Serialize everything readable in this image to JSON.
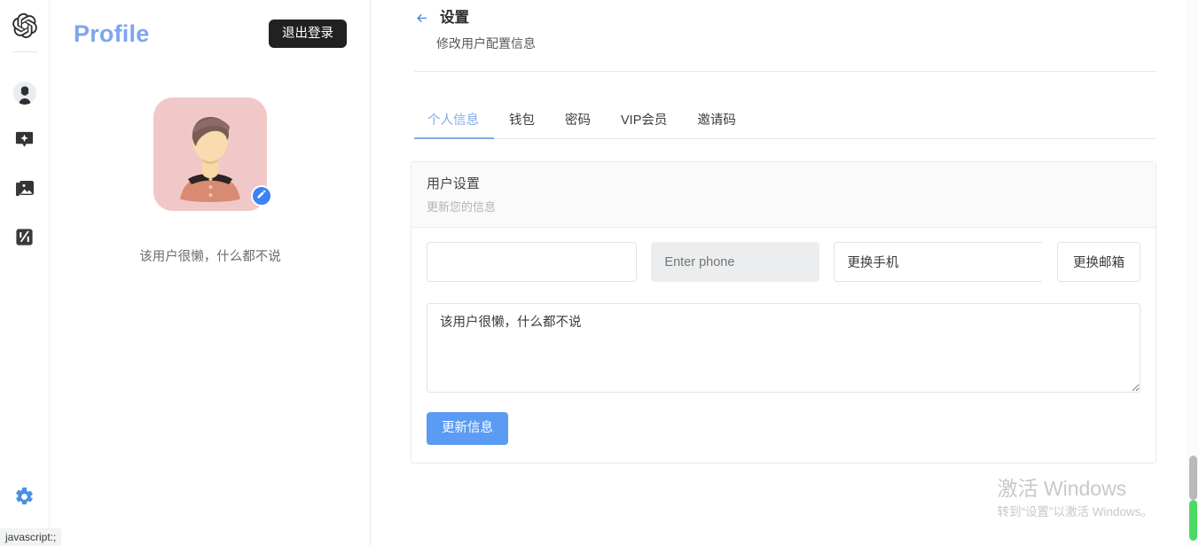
{
  "rail": {
    "logo_icon": "openai-logo-icon",
    "items": [
      {
        "icon": "user-avatar-icon",
        "name": "rail-item-account"
      },
      {
        "icon": "sparkle-badge-icon",
        "name": "rail-item-assistant"
      },
      {
        "icon": "image-library-icon",
        "name": "rail-item-gallery"
      },
      {
        "icon": "brand-mark-icon",
        "name": "rail-item-apps"
      }
    ],
    "gear_icon": "gear-icon"
  },
  "profile": {
    "title": "Profile",
    "logout_label": "退出登录",
    "avatar_alt": "user-avatar-illustration",
    "edit_icon": "pencil-icon",
    "bio": "该用户很懒，什么都不说"
  },
  "settings": {
    "back_icon": "arrow-left-icon",
    "title": "设置",
    "subtitle": "修改用户配置信息",
    "tabs": [
      {
        "label": "个人信息",
        "active": true
      },
      {
        "label": "钱包",
        "active": false
      },
      {
        "label": "密码",
        "active": false
      },
      {
        "label": "VIP会员",
        "active": false
      },
      {
        "label": "邀请码",
        "active": false
      }
    ],
    "card": {
      "title": "用户设置",
      "subtitle": "更新您的信息",
      "name_value": "",
      "name_placeholder": "",
      "phone_placeholder": "Enter phone",
      "phone_value": "",
      "change_phone_label": "更换手机",
      "change_email_label": "更换邮箱",
      "bio_value": "该用户很懒，什么都不说",
      "bio_placeholder": "",
      "submit_label": "更新信息"
    }
  },
  "watermark": {
    "line1": "激活 Windows",
    "line2": "转到“设置”以激活 Windows。"
  },
  "statusbar": {
    "text": "javascript:;"
  },
  "colors": {
    "accent_blue": "#5b9bf3",
    "tab_active": "#82a9ea",
    "profile_title": "#7ea6ec",
    "logout_bg": "#212121",
    "scroll_green": "#4cd964"
  }
}
